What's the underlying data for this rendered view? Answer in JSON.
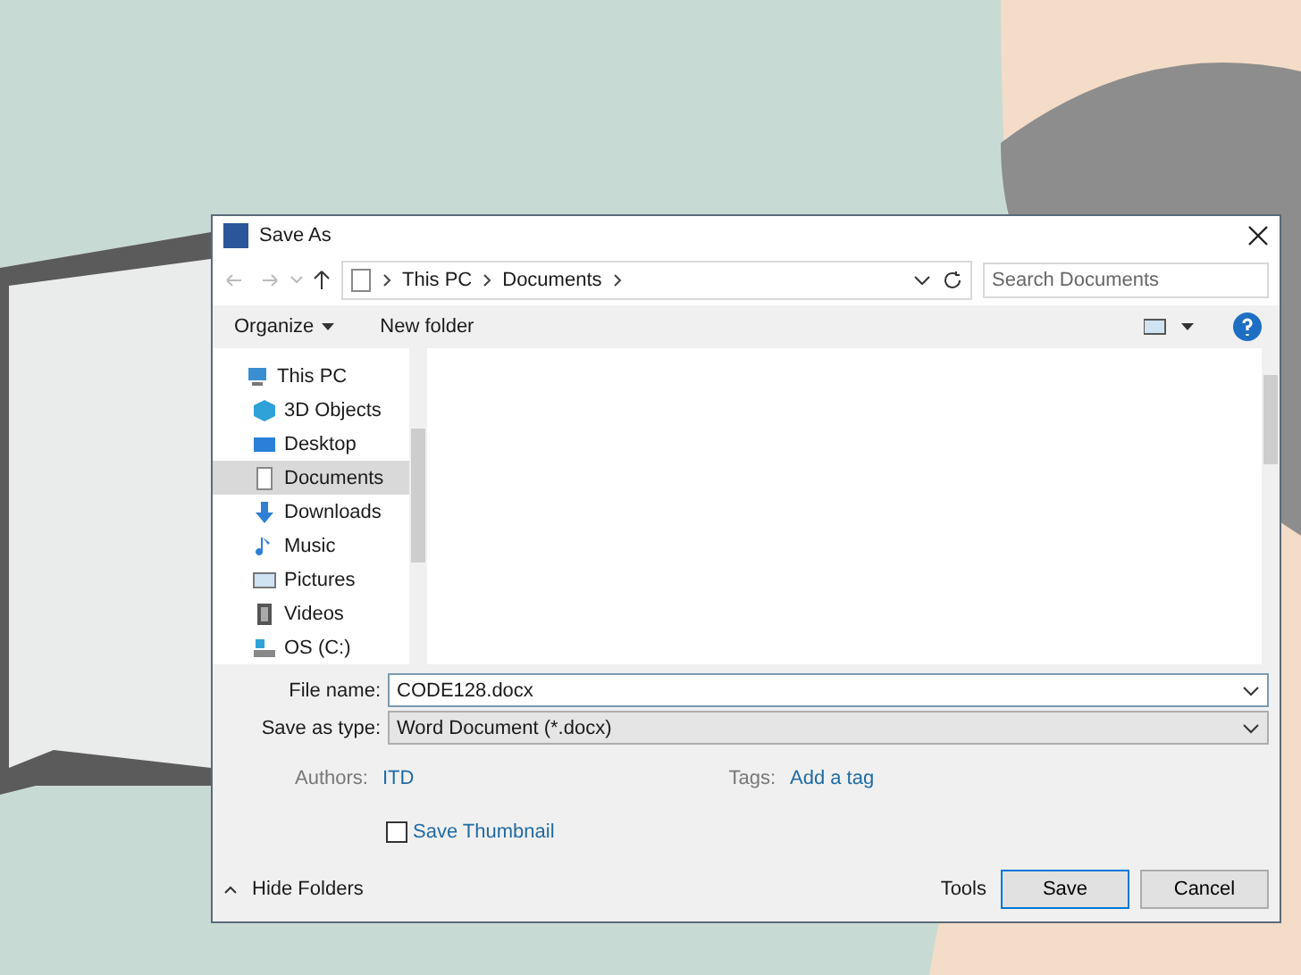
{
  "window": {
    "title": "Save As"
  },
  "address": {
    "crumbs": [
      "This PC",
      "Documents"
    ]
  },
  "search": {
    "placeholder": "Search Documents"
  },
  "toolbar": {
    "organize": "Organize",
    "new_folder": "New folder"
  },
  "nav_pane": {
    "items": [
      {
        "label": "This PC",
        "kind": "computer",
        "selected": false,
        "children": [
          {
            "label": "3D Objects",
            "kind": "cube",
            "selected": false
          },
          {
            "label": "Desktop",
            "kind": "desktop",
            "selected": false
          },
          {
            "label": "Documents",
            "kind": "documents",
            "selected": true
          },
          {
            "label": "Downloads",
            "kind": "download",
            "selected": false
          },
          {
            "label": "Music",
            "kind": "music",
            "selected": false
          },
          {
            "label": "Pictures",
            "kind": "pictures",
            "selected": false
          },
          {
            "label": "Videos",
            "kind": "videos",
            "selected": false
          },
          {
            "label": "OS (C:)",
            "kind": "drive",
            "selected": false
          }
        ]
      }
    ]
  },
  "form": {
    "file_name_label": "File name:",
    "file_name": "CODE128.docx",
    "type_label": "Save as type:",
    "type": "Word Document (*.docx)",
    "authors_label": "Authors:",
    "authors": "ITD",
    "tags_label": "Tags:",
    "tags": "Add a tag",
    "thumbnail": {
      "label": "Save Thumbnail",
      "checked": false
    }
  },
  "footer": {
    "hide_folders": "Hide Folders",
    "tools": "Tools",
    "buttons": [
      "Save",
      "Cancel"
    ]
  }
}
